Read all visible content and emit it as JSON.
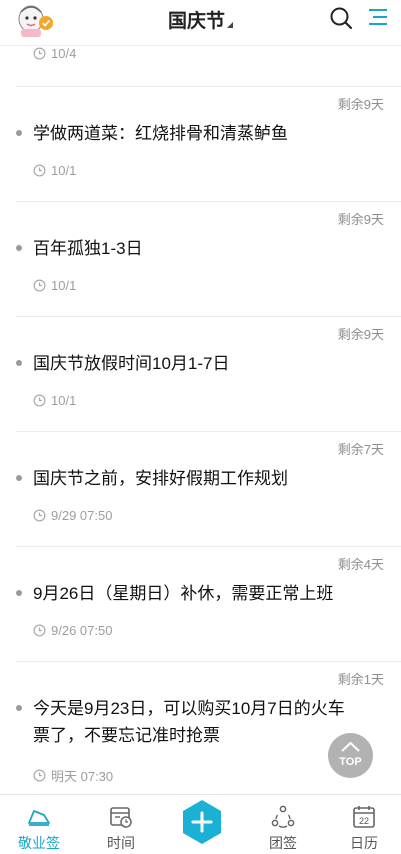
{
  "header": {
    "title": "国庆节"
  },
  "icons": {
    "avatar": "avatar-cartoon-icon",
    "search": "search-icon",
    "menu": "menu-icon",
    "clock": "clock-icon",
    "top": "back-to-top-icon",
    "add": "add-icon"
  },
  "colors": {
    "accent": "#1aa6c8",
    "bullet": "#9a9a9a",
    "muted_text": "#9d9d9d"
  },
  "list": {
    "partial_item": {
      "time": "10/4"
    },
    "items": [
      {
        "remaining": "剩余9天",
        "text": "学做两道菜：红烧排骨和清蒸鲈鱼",
        "time": "10/1"
      },
      {
        "remaining": "剩余9天",
        "text": "百年孤独1-3日",
        "time": "10/1"
      },
      {
        "remaining": "剩余9天",
        "text": "国庆节放假时间10月1-7日",
        "time": "10/1"
      },
      {
        "remaining": "剩余7天",
        "text": "国庆节之前，安排好假期工作规划",
        "time": "9/29 07:50"
      },
      {
        "remaining": "剩余4天",
        "text": "9月26日（星期日）补休，需要正常上班",
        "time": "9/26 07:50"
      },
      {
        "remaining": "剩余1天",
        "text": "今天是9月23日，可以购买10月7日的火车票了，不要忘记准时抢票",
        "time": "明天 07:30"
      }
    ]
  },
  "top_button": {
    "label": "TOP"
  },
  "tabbar": {
    "tabs": [
      {
        "label": "敬业签",
        "active": true
      },
      {
        "label": "时间",
        "active": false
      },
      {
        "label": "团签",
        "active": false
      },
      {
        "label": "日历",
        "active": false
      }
    ],
    "calendar_day": "22"
  }
}
